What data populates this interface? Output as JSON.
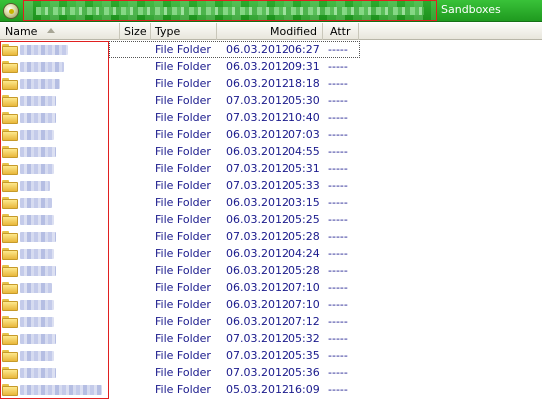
{
  "pathbar": {
    "tail_text": "Sandboxes"
  },
  "columns": {
    "name": "Name",
    "size": "Size",
    "type": "Type",
    "modified": "Modified",
    "attr": "Attr"
  },
  "rows": [
    {
      "type": "File Folder",
      "date": "06.03.2012",
      "time": "06:27",
      "attr": "-----"
    },
    {
      "type": "File Folder",
      "date": "06.03.2012",
      "time": "09:31",
      "attr": "-----"
    },
    {
      "type": "File Folder",
      "date": "06.03.2012",
      "time": "18:18",
      "attr": "-----"
    },
    {
      "type": "File Folder",
      "date": "07.03.2012",
      "time": "05:30",
      "attr": "-----"
    },
    {
      "type": "File Folder",
      "date": "07.03.2012",
      "time": "10:40",
      "attr": "-----"
    },
    {
      "type": "File Folder",
      "date": "06.03.2012",
      "time": "07:03",
      "attr": "-----"
    },
    {
      "type": "File Folder",
      "date": "06.03.2012",
      "time": "04:55",
      "attr": "-----"
    },
    {
      "type": "File Folder",
      "date": "07.03.2012",
      "time": "05:31",
      "attr": "-----"
    },
    {
      "type": "File Folder",
      "date": "07.03.2012",
      "time": "05:33",
      "attr": "-----"
    },
    {
      "type": "File Folder",
      "date": "06.03.2012",
      "time": "03:15",
      "attr": "-----"
    },
    {
      "type": "File Folder",
      "date": "06.03.2012",
      "time": "05:25",
      "attr": "-----"
    },
    {
      "type": "File Folder",
      "date": "07.03.2012",
      "time": "05:28",
      "attr": "-----"
    },
    {
      "type": "File Folder",
      "date": "06.03.2012",
      "time": "04:24",
      "attr": "-----"
    },
    {
      "type": "File Folder",
      "date": "06.03.2012",
      "time": "05:28",
      "attr": "-----"
    },
    {
      "type": "File Folder",
      "date": "06.03.2012",
      "time": "07:10",
      "attr": "-----"
    },
    {
      "type": "File Folder",
      "date": "06.03.2012",
      "time": "07:10",
      "attr": "-----"
    },
    {
      "type": "File Folder",
      "date": "06.03.2012",
      "time": "07:12",
      "attr": "-----"
    },
    {
      "type": "File Folder",
      "date": "07.03.2012",
      "time": "05:32",
      "attr": "-----"
    },
    {
      "type": "File Folder",
      "date": "07.03.2012",
      "time": "05:35",
      "attr": "-----"
    },
    {
      "type": "File Folder",
      "date": "07.03.2012",
      "time": "05:36",
      "attr": "-----"
    },
    {
      "type": "File Folder",
      "date": "05.03.2012",
      "time": "16:09",
      "attr": "-----"
    }
  ],
  "colors": {
    "pathbar": "#1f9a1f",
    "row_text": "#1a1a8c",
    "redaction_border": "#e02020"
  },
  "icons": {
    "drive": "drive-icon",
    "folder": "folder-icon",
    "sort": "sort-ascending-icon"
  }
}
